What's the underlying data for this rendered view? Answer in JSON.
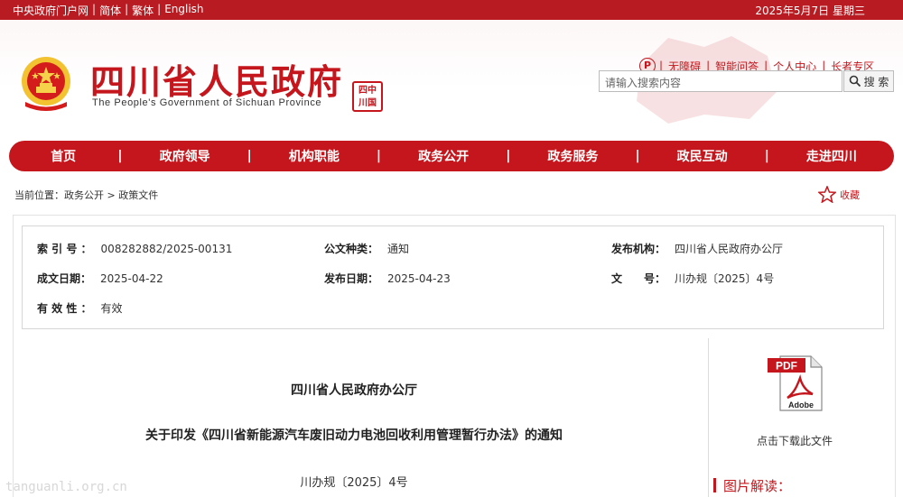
{
  "topbar": {
    "links": [
      "中央政府门户网",
      "简体",
      "繁体",
      "English"
    ],
    "date": "2025年5月7日 星期三"
  },
  "header": {
    "title": "四川省人民政府",
    "subtitle": "The People's Government of Sichuan Province",
    "seal_text": [
      "四",
      "川",
      "中",
      "国"
    ],
    "tools": [
      "无障碍",
      "智能问答",
      "个人中心",
      "长者专区"
    ],
    "search_placeholder": "请输入搜索内容",
    "search_label": "搜 索"
  },
  "nav": [
    "首页",
    "政府领导",
    "机构职能",
    "政务公开",
    "政务服务",
    "政民互动",
    "走进四川"
  ],
  "breadcrumb": "当前位置：政务公开 > 政策文件",
  "favorite_label": "收藏",
  "meta": {
    "index_label": "索 引 号 ：",
    "index_value": "008282882/2025-00131",
    "type_label": "公文种类：",
    "type_value": "通知",
    "publisher_label": "发布机构：",
    "publisher_value": "四川省人民政府办公厅",
    "written_label": "成文日期：",
    "written_value": "2025-04-22",
    "release_label": "发布日期：",
    "release_value": "2025-04-23",
    "docno_label": "文　　号：",
    "docno_value": "川办规〔2025〕4号",
    "valid_label": "有 效 性 ：",
    "valid_value": "有效"
  },
  "doc": {
    "org": "四川省人民政府办公厅",
    "title": "关于印发《四川省新能源汽车废旧动力电池回收利用管理暂行办法》的通知",
    "number": "川办规〔2025〕4号"
  },
  "download": {
    "badge": "PDF",
    "brand": "Adobe",
    "label": "点击下载此文件"
  },
  "tujie_label": "图片解读：",
  "watermark": "tanguanli.org.cn",
  "colors": {
    "brand_red": "#c4161c",
    "topbar_red": "#b81c22"
  }
}
